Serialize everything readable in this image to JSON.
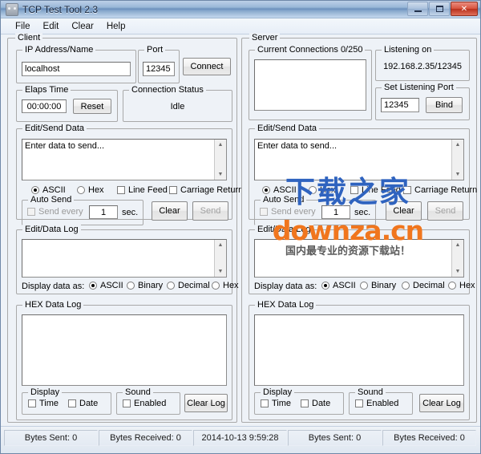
{
  "window": {
    "title": "TCP Test Tool 2.3",
    "icon": "app-icon",
    "minimize_label": "Minimize",
    "maximize_label": "Maximize",
    "close_label": "✕"
  },
  "menu": {
    "items": [
      {
        "label": "File"
      },
      {
        "label": "Edit"
      },
      {
        "label": "Clear"
      },
      {
        "label": "Help"
      }
    ]
  },
  "client": {
    "panel_title": "Client",
    "ip": {
      "group_title": "IP Address/Name",
      "value": "localhost"
    },
    "port": {
      "group_title": "Port",
      "value": "12345"
    },
    "connect_button": "Connect",
    "elaps_time": {
      "group_title": "Elaps Time",
      "value": "00:00:00",
      "reset_button": "Reset"
    },
    "connection_status": {
      "group_title": "Connection Status",
      "value": "Idle"
    },
    "send_data": {
      "group_title": "Edit/Send Data",
      "text": "Enter data to send...",
      "format_ascii": "ASCII",
      "format_hex": "Hex",
      "line_feed": "Line Feed",
      "carriage_return": "Carriage Return",
      "auto_send_title": "Auto Send",
      "send_every": "Send every",
      "interval": "1",
      "sec_label": "sec.",
      "clear_button": "Clear",
      "send_button": "Send"
    },
    "data_log": {
      "group_title": "Edit/Data Log",
      "text": "",
      "display_label": "Display data as:",
      "options": [
        "ASCII",
        "Binary",
        "Decimal",
        "Hex"
      ],
      "selected": "ASCII"
    },
    "hex_log": {
      "group_title": "HEX Data Log",
      "text": "",
      "display_title": "Display",
      "time_label": "Time",
      "date_label": "Date",
      "sound_title": "Sound",
      "enabled_label": "Enabled",
      "clear_log_button": "Clear Log"
    }
  },
  "server": {
    "panel_title": "Server",
    "connections": {
      "group_title": "Current Connections 0/250",
      "text": ""
    },
    "listening_on": {
      "group_title": "Listening on",
      "value": "192.168.2.35/12345"
    },
    "set_port": {
      "group_title": "Set Listening Port",
      "value": "12345",
      "bind_button": "Bind"
    },
    "send_data": {
      "group_title": "Edit/Send Data",
      "text": "Enter data to send...",
      "format_ascii": "ASCII",
      "format_hex": "Hex",
      "line_feed": "Line Feed",
      "carriage_return": "Carriage Return",
      "auto_send_title": "Auto Send",
      "send_every": "Send every",
      "interval": "1",
      "sec_label": "sec.",
      "clear_button": "Clear",
      "send_button": "Send"
    },
    "data_log": {
      "group_title": "Edit/Data Log",
      "text": "",
      "display_label": "Display data as:",
      "options": [
        "ASCII",
        "Binary",
        "Decimal",
        "Hex"
      ],
      "selected": "ASCII"
    },
    "hex_log": {
      "group_title": "HEX Data Log",
      "text": "",
      "display_title": "Display",
      "time_label": "Time",
      "date_label": "Date",
      "sound_title": "Sound",
      "enabled_label": "Enabled",
      "clear_log_button": "Clear Log"
    }
  },
  "statusbar": {
    "cells": [
      {
        "label": "Bytes Sent: 0"
      },
      {
        "label": "Bytes Received: 0"
      },
      {
        "label": "2014-10-13 9:59:28"
      },
      {
        "label": "Bytes Sent: 0"
      },
      {
        "label": "Bytes Received: 0"
      }
    ]
  },
  "watermark": {
    "line1": "下载之家",
    "line2": "downza.cn",
    "line3": "国内最专业的资源下载站！",
    "color_blue": "#2f63bf",
    "color_orange": "#f0761e"
  }
}
